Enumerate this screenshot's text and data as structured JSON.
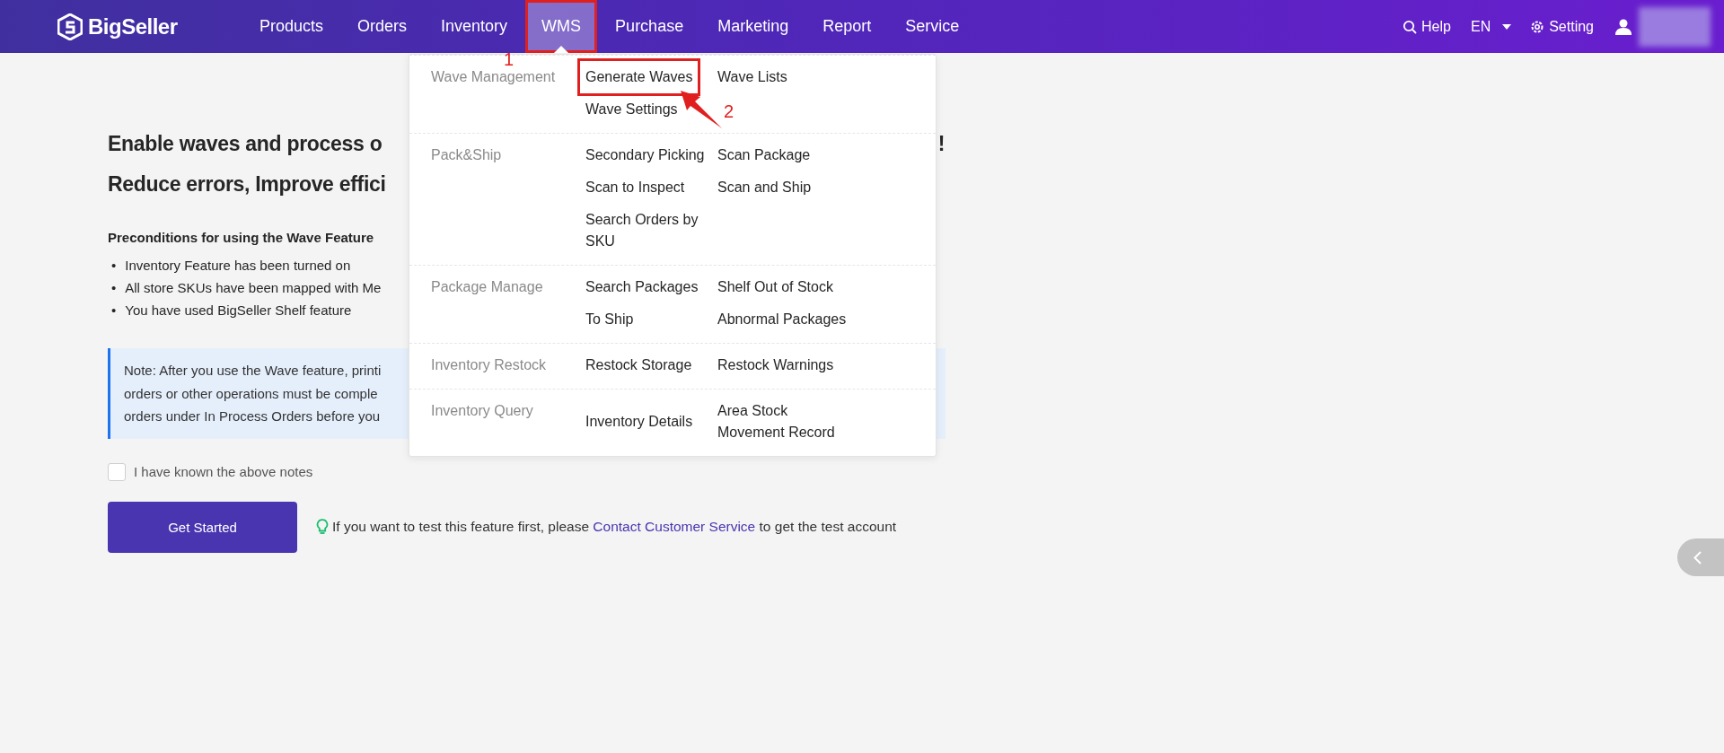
{
  "header": {
    "logo": "BigSeller",
    "nav": [
      {
        "label": "Products",
        "selected": false
      },
      {
        "label": "Orders",
        "selected": false
      },
      {
        "label": "Inventory",
        "selected": false
      },
      {
        "label": "WMS",
        "selected": true,
        "annotated": true
      },
      {
        "label": "Purchase",
        "selected": false
      },
      {
        "label": "Marketing",
        "selected": false
      },
      {
        "label": "Report",
        "selected": false
      },
      {
        "label": "Service",
        "selected": false
      }
    ],
    "help": "Help",
    "language": "EN",
    "setting": "Setting"
  },
  "dropdown": {
    "groups": [
      {
        "category": "Wave Management",
        "items": [
          {
            "label": "Generate Waves",
            "annotated": true
          },
          {
            "label": "Wave Lists"
          },
          {
            "label": "Wave Settings"
          }
        ]
      },
      {
        "category": "Pack&Ship",
        "items": [
          {
            "label": "Secondary Picking"
          },
          {
            "label": "Scan Package"
          },
          {
            "label": "Scan to Inspect"
          },
          {
            "label": "Scan and Ship"
          },
          {
            "label": "Search Orders by SKU"
          }
        ]
      },
      {
        "category": "Package Manage",
        "items": [
          {
            "label": "Search Packages"
          },
          {
            "label": "Shelf Out of Stock"
          },
          {
            "label": "To Ship"
          },
          {
            "label": "Abnormal Packages"
          }
        ]
      },
      {
        "category": "Inventory Restock",
        "items": [
          {
            "label": "Restock Storage"
          },
          {
            "label": "Restock Warnings"
          }
        ]
      },
      {
        "category": "Inventory Query",
        "items": [
          {
            "label": "Inventory Details"
          },
          {
            "label": "Area Stock Movement Record"
          }
        ]
      }
    ]
  },
  "annotations": [
    {
      "label": "1"
    },
    {
      "label": "2"
    }
  ],
  "intro": {
    "headline": [
      "Enable waves and process o",
      "Reduce errors, Improve effici"
    ],
    "headline_end": "!",
    "preconditions_title": "Preconditions for using the Wave Feature",
    "preconditions": [
      {
        "marker": "•",
        "text": "Inventory Feature has been turned on"
      },
      {
        "marker": "•",
        "text": "All store SKUs have been mapped with Me"
      },
      {
        "marker": "•",
        "text": "You have used BigSeller Shelf feature"
      }
    ],
    "note_lines": [
      "Note: After you use the Wave feature, printi",
      "orders or other operations must be comple",
      "orders under In Process Orders before you"
    ],
    "acknowledge": {
      "label": "I have known the above notes",
      "checked": false
    },
    "button": "Get Started",
    "tip": {
      "before": "If you want to test this feature first, please ",
      "link": "Contact Customer Service",
      "after": " to get the test account"
    }
  }
}
